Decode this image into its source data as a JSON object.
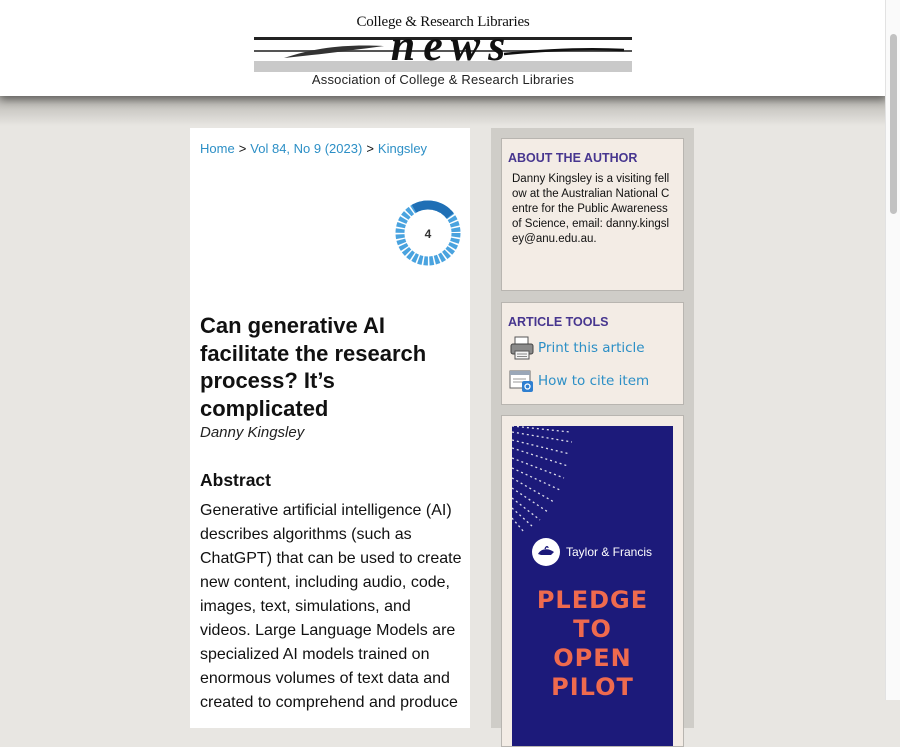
{
  "masthead": {
    "logo_top": "College & Research Libraries",
    "logo_word": "news",
    "logo_bottom": "Association of College & Research Libraries"
  },
  "breadcrumb": {
    "home": "Home",
    "separator": ">",
    "issue": "Vol 84, No 9 (2023)",
    "current": "Kingsley"
  },
  "altmetric": {
    "score": "4"
  },
  "article": {
    "title": "Can generative AI facilitate the research process? It’s complicated",
    "author": "Danny Kingsley",
    "abstract_heading": "Abstract",
    "abstract_text": "Generative artificial intelligence (AI) describes algorithms (such as ChatGPT) that can be used to create new content, including audio, code, images, text, simulations, and videos. Large Language Models are specialized AI models trained on enormous volumes of text data and created to comprehend and produce"
  },
  "sidebar": {
    "about": {
      "title": "ABOUT THE AUTHOR",
      "text": "Danny Kingsley is a visiting fellow at the Australian National Centre for the Public Awareness of Science, email: danny.kingsley@anu.edu.au."
    },
    "tools": {
      "title": "ARTICLE TOOLS",
      "items": [
        {
          "label": "Print this article",
          "icon": "printer-icon"
        },
        {
          "label": "How to cite item",
          "icon": "cite-document-icon"
        }
      ]
    },
    "ad": {
      "brand": "Taylor & Francis",
      "headline": [
        "PLEDGE",
        "TO",
        "OPEN",
        "PILOT"
      ]
    }
  },
  "colors": {
    "link": "#2c8fc6",
    "sidebar_heading": "#47368f",
    "ad_background": "#1c1a7a",
    "ad_headline": "#ef6a4e",
    "page_background": "#e8e6e2"
  }
}
